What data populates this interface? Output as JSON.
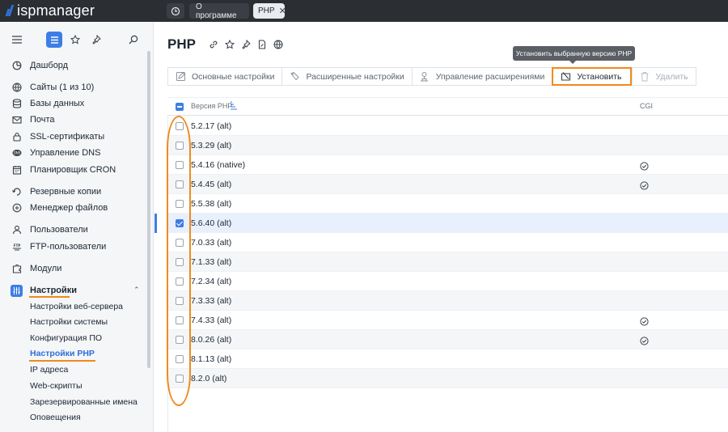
{
  "topbar": {
    "logo": "ispmanager",
    "tabs": [
      {
        "label": "О программе"
      },
      {
        "label": "PHP",
        "close": "✕"
      }
    ]
  },
  "sidebar": {
    "items": [
      {
        "label": "Дашборд",
        "icon": "dashboard-icon"
      },
      {
        "label": "Сайты (1 из 10)",
        "icon": "globe-icon"
      },
      {
        "label": "Базы данных",
        "icon": "database-icon"
      },
      {
        "label": "Почта",
        "icon": "mail-icon"
      },
      {
        "label": "SSL-сертификаты",
        "icon": "certificate-icon"
      },
      {
        "label": "Управление DNS",
        "icon": "dns-icon"
      },
      {
        "label": "Планировщик CRON",
        "icon": "calendar-icon"
      },
      {
        "label": "Резервные копии",
        "icon": "backup-icon"
      },
      {
        "label": "Менеджер файлов",
        "icon": "folder-icon"
      },
      {
        "label": "Пользователи",
        "icon": "user-icon"
      },
      {
        "label": "FTP-пользователи",
        "icon": "ftp-icon"
      },
      {
        "label": "Модули",
        "icon": "modules-icon"
      },
      {
        "label": "Настройки",
        "icon": "settings-icon"
      }
    ],
    "subitems": [
      {
        "label": "Настройки веб-сервера"
      },
      {
        "label": "Настройки системы"
      },
      {
        "label": "Конфигурация ПО"
      },
      {
        "label": "Настройки PHP"
      },
      {
        "label": "IP адреса"
      },
      {
        "label": "Web-скрипты"
      },
      {
        "label": "Зарезервированные имена"
      },
      {
        "label": "Оповещения"
      }
    ]
  },
  "main": {
    "title": "PHP",
    "toolbar": {
      "basic": "Основные настройки",
      "advanced": "Расширенные настройки",
      "extensions": "Управление расширениями",
      "install": "Установить",
      "delete": "Удалить",
      "tooltip": "Установить выбранную версию PHP"
    },
    "table": {
      "columns": {
        "version": "Версия PHP",
        "cgi": "CGI"
      },
      "rows": [
        {
          "version": "5.2.17 (alt)",
          "cgi": false,
          "checked": false
        },
        {
          "version": "5.3.29 (alt)",
          "cgi": false,
          "checked": false
        },
        {
          "version": "5.4.16 (native)",
          "cgi": true,
          "checked": false
        },
        {
          "version": "5.4.45 (alt)",
          "cgi": true,
          "checked": false
        },
        {
          "version": "5.5.38 (alt)",
          "cgi": false,
          "checked": false
        },
        {
          "version": "5.6.40 (alt)",
          "cgi": false,
          "checked": true
        },
        {
          "version": "7.0.33 (alt)",
          "cgi": false,
          "checked": false
        },
        {
          "version": "7.1.33 (alt)",
          "cgi": false,
          "checked": false
        },
        {
          "version": "7.2.34 (alt)",
          "cgi": false,
          "checked": false
        },
        {
          "version": "7.3.33 (alt)",
          "cgi": false,
          "checked": false
        },
        {
          "version": "7.4.33 (alt)",
          "cgi": true,
          "checked": false
        },
        {
          "version": "8.0.26 (alt)",
          "cgi": true,
          "checked": false
        },
        {
          "version": "8.1.13 (alt)",
          "cgi": false,
          "checked": false
        },
        {
          "version": "8.2.0 (alt)",
          "cgi": false,
          "checked": false
        }
      ]
    }
  },
  "colors": {
    "accent": "#3d7ee6",
    "highlight": "#f08a1c",
    "topbar": "#2b2e33"
  }
}
